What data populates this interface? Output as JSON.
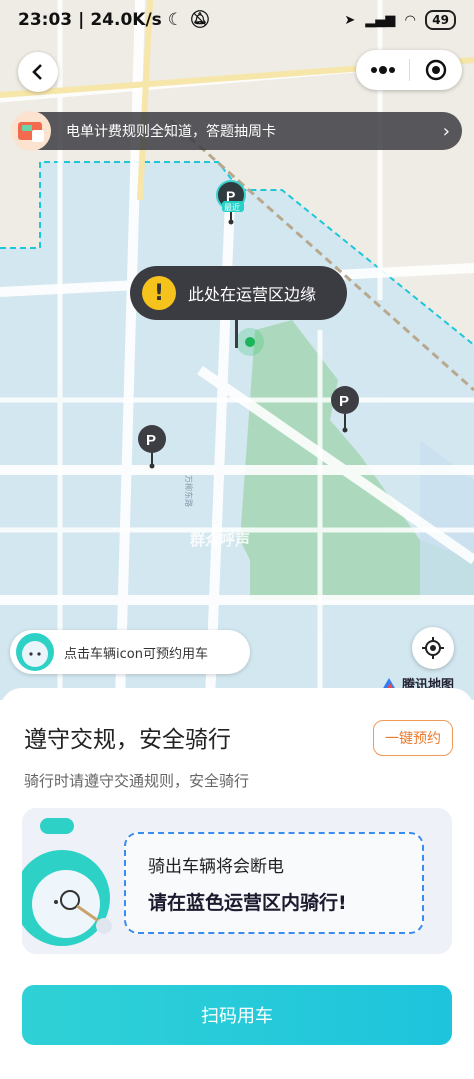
{
  "status_bar": {
    "time": "23:03",
    "speed": "24.0K/s",
    "battery": "49"
  },
  "header": {
    "back_icon": "chevron-left-icon",
    "more_icon": "more-dots-icon",
    "target_icon": "record-target-icon"
  },
  "notice": {
    "text": "电单计费规则全知道，答题抽周卡"
  },
  "map": {
    "tooltip_text": "此处在运营区边缘",
    "parking_label": "P",
    "nearest_badge": "最近",
    "road_labels": [
      "万柳东路",
      "群众呼声"
    ],
    "accent_zone_color": "#1ec7d8",
    "park_color": "#7fc79a"
  },
  "hint": {
    "text": "点击车辆icon可预约用车"
  },
  "map_logo": {
    "text": "腾讯地图"
  },
  "panel": {
    "title": "遵守交规，安全骑行",
    "subtitle": "骑行时请遵守交通规则，安全骑行",
    "reserve_button": "一键预约",
    "banner_line1": "骑出车辆将会断电",
    "banner_line2": "请在蓝色运营区内骑行!",
    "scan_button": "扫码用车"
  }
}
